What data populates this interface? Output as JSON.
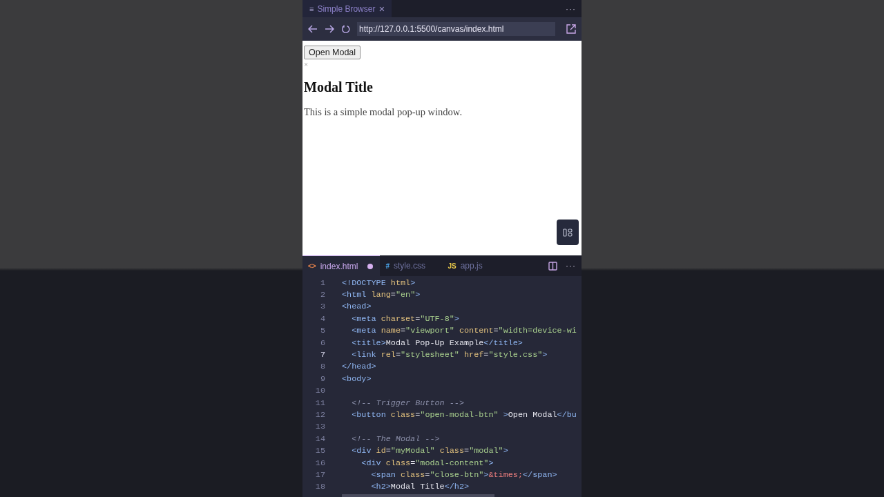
{
  "browser": {
    "tab": {
      "icon": "≡",
      "title": "Simple Browser",
      "close": "×"
    },
    "more": "···",
    "url": "http://127.0.0.1:5500/canvas/index.html"
  },
  "page": {
    "button": "Open Modal",
    "close": "×",
    "title": "Modal Title",
    "text": "This is a simple modal pop-up window."
  },
  "editor_tabs": [
    {
      "icon": "<>",
      "label": "index.html",
      "selected": true,
      "modified": true,
      "color": "#e8834a"
    },
    {
      "icon": "#",
      "label": "style.css",
      "selected": false,
      "modified": false,
      "color": "#4aa3e8"
    },
    {
      "icon": "JS",
      "label": "app.js",
      "selected": false,
      "modified": false,
      "color": "#e8c94a"
    }
  ],
  "editor_more": "···",
  "lines": [
    {
      "n": "1",
      "active": false,
      "tokens": [
        {
          "kind": "tag",
          "text": "<!DOCTYPE "
        },
        {
          "kind": "attr",
          "text": "html"
        },
        {
          "kind": "tag",
          "text": ">"
        }
      ]
    },
    {
      "n": "2",
      "active": false,
      "tokens": [
        {
          "kind": "tag",
          "text": "<html "
        },
        {
          "kind": "attr",
          "text": "lang"
        },
        {
          "kind": "plain",
          "text": "="
        },
        {
          "kind": "str",
          "text": "\"en\""
        },
        {
          "kind": "tag",
          "text": ">"
        }
      ]
    },
    {
      "n": "3",
      "active": false,
      "tokens": [
        {
          "kind": "tag",
          "text": "<head>"
        }
      ]
    },
    {
      "n": "4",
      "active": false,
      "tokens": [
        {
          "kind": "tag",
          "text": "  <meta "
        },
        {
          "kind": "attr",
          "text": "charset"
        },
        {
          "kind": "plain",
          "text": "="
        },
        {
          "kind": "str",
          "text": "\"UTF-8\""
        },
        {
          "kind": "tag",
          "text": ">"
        }
      ]
    },
    {
      "n": "5",
      "active": false,
      "tokens": [
        {
          "kind": "tag",
          "text": "  <meta "
        },
        {
          "kind": "attr",
          "text": "name"
        },
        {
          "kind": "plain",
          "text": "="
        },
        {
          "kind": "str",
          "text": "\"viewport\""
        },
        {
          "kind": "attr",
          "text": " content"
        },
        {
          "kind": "plain",
          "text": "="
        },
        {
          "kind": "str",
          "text": "\"width=device-wi"
        }
      ]
    },
    {
      "n": "6",
      "active": false,
      "tokens": [
        {
          "kind": "tag",
          "text": "  <title>"
        },
        {
          "kind": "plain",
          "text": "Modal Pop-Up Example"
        },
        {
          "kind": "tag",
          "text": "</title>"
        }
      ]
    },
    {
      "n": "7",
      "active": true,
      "tokens": [
        {
          "kind": "tag",
          "text": "  <link "
        },
        {
          "kind": "attr",
          "text": "rel"
        },
        {
          "kind": "plain",
          "text": "="
        },
        {
          "kind": "str",
          "text": "\"stylesheet\""
        },
        {
          "kind": "attr",
          "text": " href"
        },
        {
          "kind": "plain",
          "text": "="
        },
        {
          "kind": "str",
          "text": "\"style.css\""
        },
        {
          "kind": "tag",
          "text": ">"
        }
      ]
    },
    {
      "n": "8",
      "active": false,
      "tokens": [
        {
          "kind": "tag",
          "text": "</head>"
        }
      ]
    },
    {
      "n": "9",
      "active": false,
      "tokens": [
        {
          "kind": "tag",
          "text": "<body>"
        }
      ]
    },
    {
      "n": "10",
      "active": false
    },
    {
      "n": "11",
      "active": false,
      "tokens": [
        {
          "kind": "comment",
          "text": "  <!-- Trigger Button -->"
        }
      ]
    },
    {
      "n": "12",
      "active": false,
      "tokens": [
        {
          "kind": "tag",
          "text": "  <button "
        },
        {
          "kind": "attr",
          "text": "class"
        },
        {
          "kind": "plain",
          "text": "="
        },
        {
          "kind": "str",
          "text": "\"open-modal-btn\""
        },
        {
          "kind": "tag",
          "text": " >"
        },
        {
          "kind": "plain",
          "text": "Open Modal"
        },
        {
          "kind": "tag",
          "text": "</bu"
        }
      ]
    },
    {
      "n": "13",
      "active": false
    },
    {
      "n": "14",
      "active": false,
      "tokens": [
        {
          "kind": "comment",
          "text": "  <!-- The Modal -->"
        }
      ]
    },
    {
      "n": "15",
      "active": false,
      "tokens": [
        {
          "kind": "tag",
          "text": "  <div "
        },
        {
          "kind": "attr",
          "text": "id"
        },
        {
          "kind": "plain",
          "text": "="
        },
        {
          "kind": "str",
          "text": "\"myModal\""
        },
        {
          "kind": "attr",
          "text": " class"
        },
        {
          "kind": "plain",
          "text": "="
        },
        {
          "kind": "str",
          "text": "\"modal\""
        },
        {
          "kind": "tag",
          "text": ">"
        }
      ]
    },
    {
      "n": "16",
      "active": false,
      "tokens": [
        {
          "kind": "tag",
          "text": "    <div "
        },
        {
          "kind": "attr",
          "text": "class"
        },
        {
          "kind": "plain",
          "text": "="
        },
        {
          "kind": "str",
          "text": "\"modal-content\""
        },
        {
          "kind": "tag",
          "text": ">"
        }
      ]
    },
    {
      "n": "17",
      "active": false,
      "tokens": [
        {
          "kind": "tag",
          "text": "      <span "
        },
        {
          "kind": "attr",
          "text": "class"
        },
        {
          "kind": "plain",
          "text": "="
        },
        {
          "kind": "str",
          "text": "\"close-btn\""
        },
        {
          "kind": "tag",
          "text": ">"
        },
        {
          "kind": "entity",
          "text": "&times;"
        },
        {
          "kind": "tag",
          "text": "</span>"
        }
      ]
    },
    {
      "n": "18",
      "active": false,
      "tokens": [
        {
          "kind": "tag",
          "text": "      <h2>"
        },
        {
          "kind": "plain",
          "text": "Modal Title"
        },
        {
          "kind": "tag",
          "text": "</h2>"
        }
      ]
    }
  ]
}
